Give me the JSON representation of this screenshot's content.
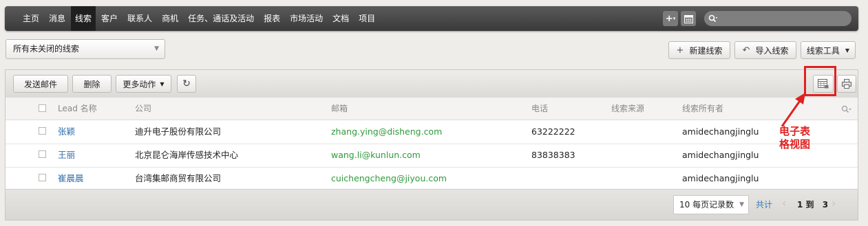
{
  "nav": {
    "items": [
      "主页",
      "消息",
      "线索",
      "客户",
      "联系人",
      "商机",
      "任务、通话及活动",
      "报表",
      "市场活动",
      "文档",
      "项目"
    ],
    "active_index": 2,
    "add_button": "+▾",
    "search_placeholder": ""
  },
  "view": {
    "selected": "所有未关闭的线索"
  },
  "actions": {
    "new_lead": "新建线索",
    "import_leads": "导入线索",
    "lead_tools": "线索工具"
  },
  "toolbar": {
    "send_email": "发送邮件",
    "delete": "删除",
    "more_actions": "更多动作"
  },
  "table": {
    "columns": [
      "Lead 名称",
      "公司",
      "邮箱",
      "电话",
      "线索来源",
      "线索所有者"
    ],
    "rows": [
      {
        "name": "张颖",
        "company": "迪升电子股份有限公司",
        "email": "zhang.ying@disheng.com",
        "phone": "63222222",
        "source": "",
        "owner": "amidechangjinglu"
      },
      {
        "name": "王丽",
        "company": "北京昆仑海岸传感技术中心",
        "email": "wang.li@kunlun.com",
        "phone": "83838383",
        "source": "",
        "owner": "amidechangjinglu"
      },
      {
        "name": "崔晨晨",
        "company": "台湾集邮商贸有限公司",
        "email": "cuichengcheng@jiyou.com",
        "phone": "",
        "source": "",
        "owner": "amidechangjinglu"
      }
    ]
  },
  "pager": {
    "per_page": "10 每页记录数",
    "total_label": "共计",
    "range": "1 到",
    "total": "3"
  },
  "annotation": {
    "label_line1": "电子表",
    "label_line2": "格视图",
    "color": "#e02020"
  }
}
